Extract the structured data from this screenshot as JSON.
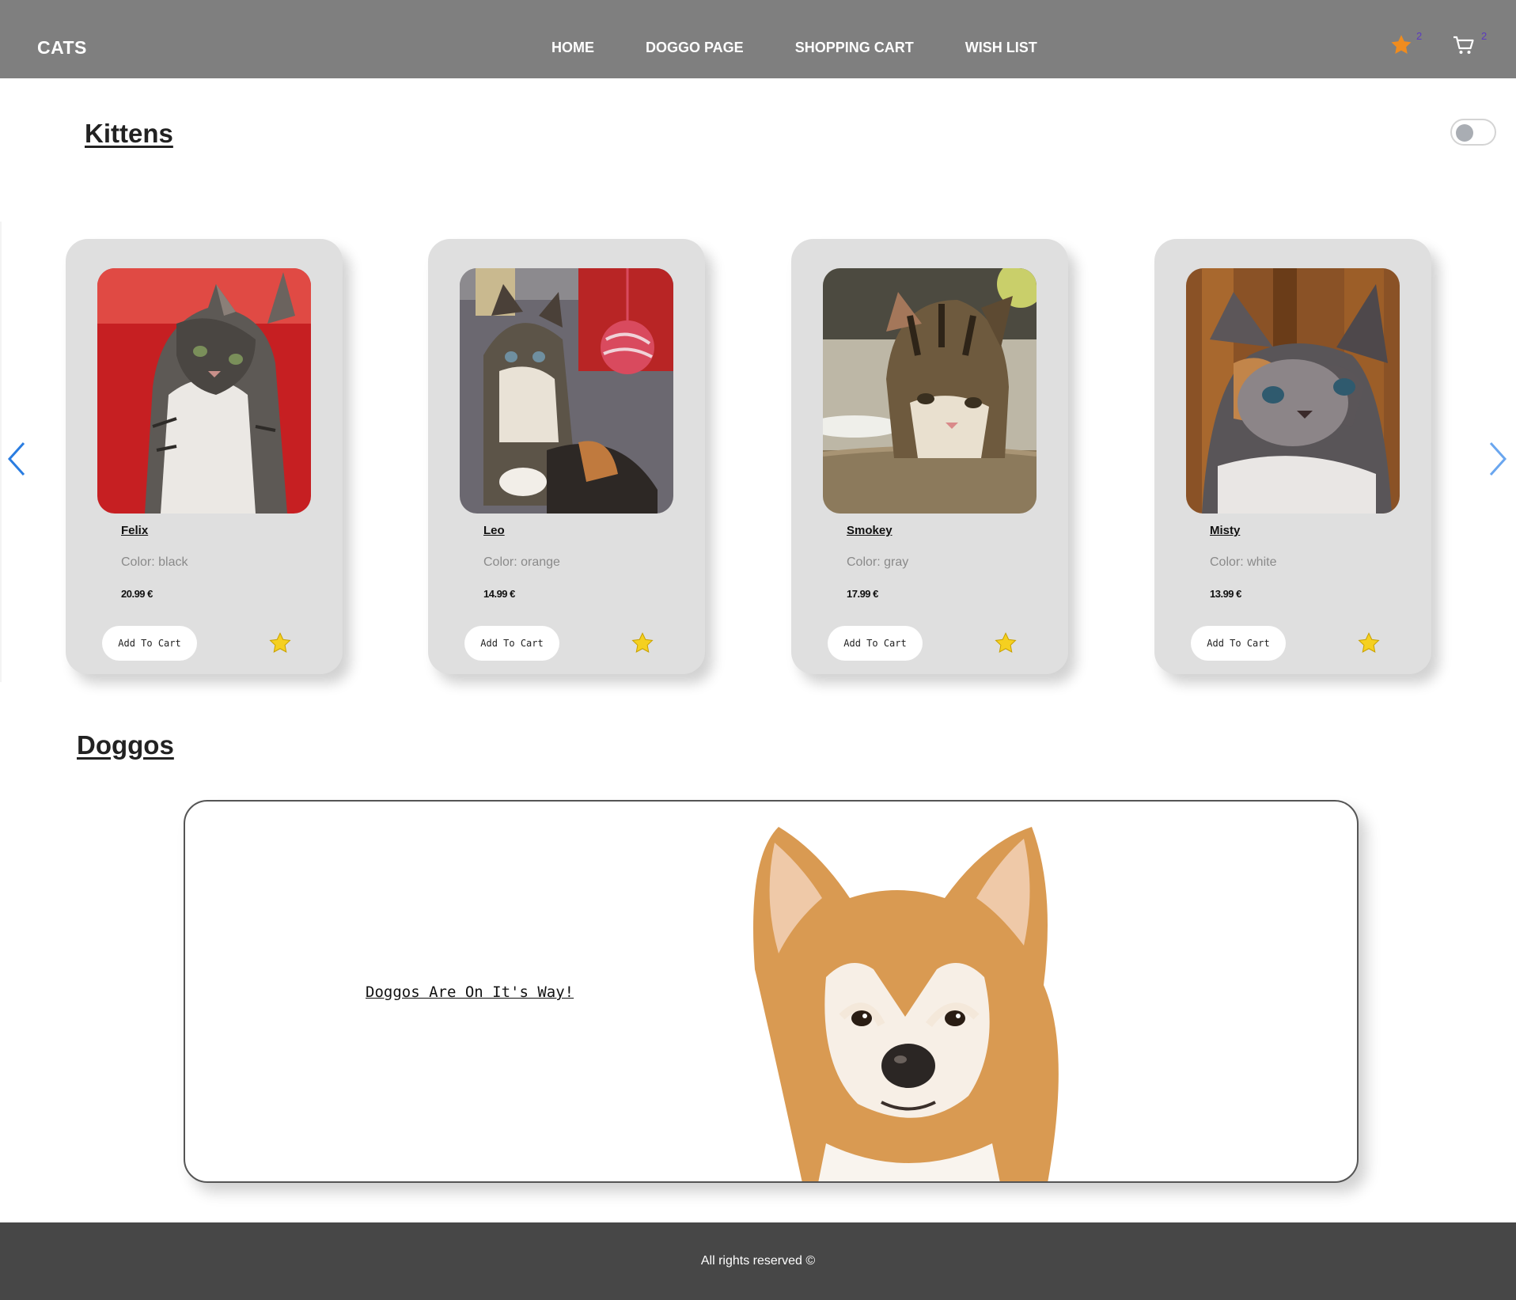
{
  "brand": "CATS",
  "nav": {
    "links": [
      "HOME",
      "DOGGO PAGE",
      "SHOPPING CART",
      "WISH LIST"
    ],
    "wishlist_count": "2",
    "cart_count": "2"
  },
  "colors": {
    "navbar": "#7f7f7f",
    "card_bg": "#dfdfdf",
    "footer": "#474747",
    "star": "#f5d020",
    "nav_star": "#f08c1e",
    "arrow": "#2a7de1",
    "badge": "#5b3bbf"
  },
  "kittens": {
    "title": "Kittens",
    "cards": [
      {
        "name": "Felix",
        "color": "Color: black",
        "price": "20.99 €",
        "button": "Add To Cart"
      },
      {
        "name": "Leo",
        "color": "Color: orange",
        "price": "14.99 €",
        "button": "Add To Cart"
      },
      {
        "name": "Smokey",
        "color": "Color: gray",
        "price": "17.99 €",
        "button": "Add To Cart"
      },
      {
        "name": "Misty",
        "color": "Color: white",
        "price": "13.99 €",
        "button": "Add To Cart"
      }
    ]
  },
  "doggos": {
    "title": "Doggos",
    "message": "Doggos Are On It's Way!"
  },
  "footer": {
    "text": "All rights reserved ©"
  }
}
